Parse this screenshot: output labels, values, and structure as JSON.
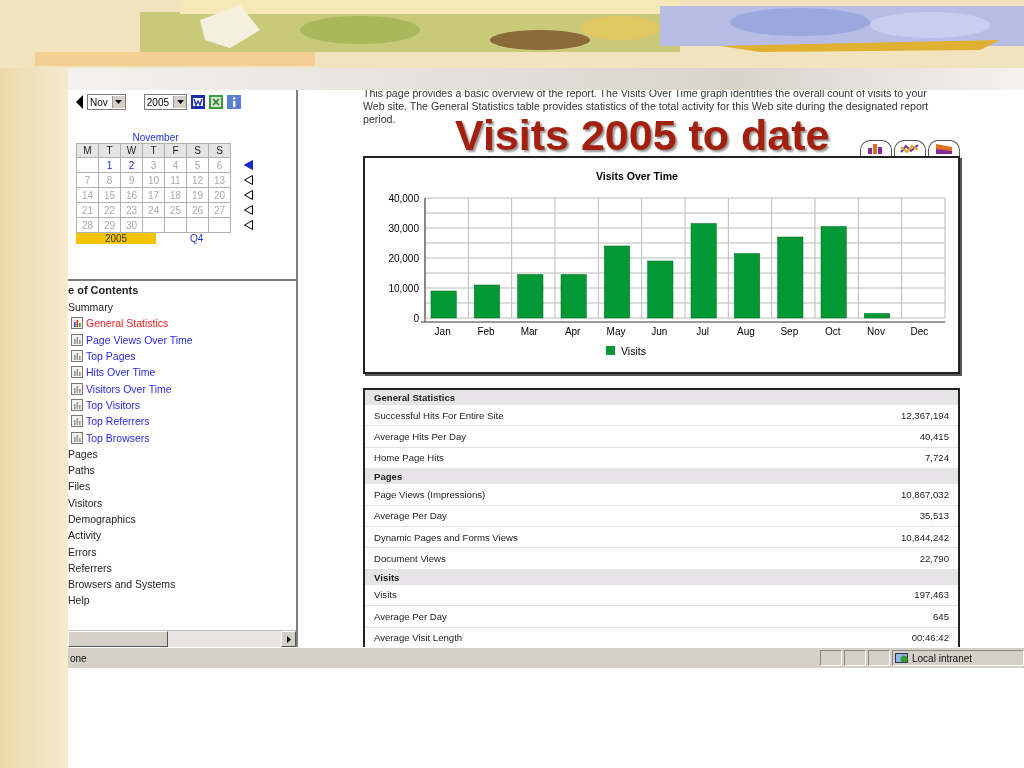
{
  "slide_title": "Visits 2005 to date",
  "nav": {
    "month": "Nov",
    "year": "2005"
  },
  "calendar": {
    "title": "November",
    "weekdays": [
      "M",
      "T",
      "W",
      "T",
      "F",
      "S",
      "S"
    ],
    "weeks": [
      {
        "selected": true,
        "days": [
          {
            "text": "1",
            "enabled": true
          },
          {
            "text": "2",
            "enabled": true
          },
          {
            "text": "3",
            "enabled": false
          },
          {
            "text": "4",
            "enabled": false
          },
          {
            "text": "5",
            "enabled": false
          },
          {
            "text": "6",
            "enabled": false
          }
        ]
      },
      {
        "selected": false,
        "days": [
          {
            "text": "7",
            "enabled": false
          },
          {
            "text": "8",
            "enabled": false
          },
          {
            "text": "9",
            "enabled": false
          },
          {
            "text": "10",
            "enabled": false
          },
          {
            "text": "11",
            "enabled": false
          },
          {
            "text": "12",
            "enabled": false
          },
          {
            "text": "13",
            "enabled": false
          }
        ]
      },
      {
        "selected": false,
        "days": [
          {
            "text": "14",
            "enabled": false
          },
          {
            "text": "15",
            "enabled": false
          },
          {
            "text": "16",
            "enabled": false
          },
          {
            "text": "17",
            "enabled": false
          },
          {
            "text": "18",
            "enabled": false
          },
          {
            "text": "19",
            "enabled": false
          },
          {
            "text": "20",
            "enabled": false
          }
        ]
      },
      {
        "selected": false,
        "days": [
          {
            "text": "21",
            "enabled": false
          },
          {
            "text": "22",
            "enabled": false
          },
          {
            "text": "23",
            "enabled": false
          },
          {
            "text": "24",
            "enabled": false
          },
          {
            "text": "25",
            "enabled": false
          },
          {
            "text": "26",
            "enabled": false
          },
          {
            "text": "27",
            "enabled": false
          }
        ]
      },
      {
        "selected": false,
        "days": [
          {
            "text": "28",
            "enabled": false
          },
          {
            "text": "29",
            "enabled": false
          },
          {
            "text": "30",
            "enabled": false
          }
        ]
      }
    ],
    "year": "2005",
    "quarter": "Q4"
  },
  "toc": {
    "title": "e of Contents",
    "items": [
      {
        "label": "Summary",
        "selected": false,
        "children": [
          {
            "label": "General Statistics",
            "selected": true
          },
          {
            "label": "Page Views Over Time",
            "selected": false
          },
          {
            "label": "Top Pages",
            "selected": false
          },
          {
            "label": "Hits Over Time",
            "selected": false
          },
          {
            "label": "Visitors Over Time",
            "selected": false
          },
          {
            "label": "Top Visitors",
            "selected": false
          },
          {
            "label": "Top Referrers",
            "selected": false
          },
          {
            "label": "Top Browsers",
            "selected": false
          }
        ]
      },
      {
        "label": "Pages",
        "selected": false
      },
      {
        "label": "Paths",
        "selected": false
      },
      {
        "label": "Files",
        "selected": false
      },
      {
        "label": "Visitors",
        "selected": false
      },
      {
        "label": "Demographics",
        "selected": false
      },
      {
        "label": "Activity",
        "selected": false
      },
      {
        "label": "Errors",
        "selected": false
      },
      {
        "label": "Referrers",
        "selected": false
      },
      {
        "label": "Browsers and Systems",
        "selected": false
      },
      {
        "label": "Help",
        "selected": false
      }
    ]
  },
  "intro": "This page provides a basic overview of the report. The Visits Over Time graph identifies the overall count of visits to your Web site. The General Statistics table provides statistics of the total activity for this Web site during the designated report period.",
  "chart": {
    "chart_data": {
      "type": "bar",
      "title": "Visits Over Time",
      "categories": [
        "Jan",
        "Feb",
        "Mar",
        "Apr",
        "May",
        "Jun",
        "Jul",
        "Aug",
        "Sep",
        "Oct",
        "Nov",
        "Dec"
      ],
      "series": [
        {
          "name": "Visits",
          "color": "#009933",
          "values": [
            9000,
            11000,
            14500,
            14500,
            24000,
            19000,
            31500,
            21500,
            27000,
            30500,
            1500,
            0
          ]
        }
      ],
      "ylim": [
        0,
        40000
      ],
      "grid": true,
      "yticks": [
        {
          "value": 0,
          "label": "0"
        },
        {
          "value": 10000,
          "label": "10,000"
        },
        {
          "value": 20000,
          "label": "20,000"
        },
        {
          "value": 30000,
          "label": "30,000"
        },
        {
          "value": 40000,
          "label": "40,000"
        }
      ]
    }
  },
  "table": {
    "sections": [
      {
        "title": "General Statistics",
        "rows": [
          {
            "label": "Successful Hits For Entire Site",
            "value": "12,367,194"
          },
          {
            "label": "Average Hits Per Day",
            "value": "40,415"
          },
          {
            "label": "Home Page Hits",
            "value": "7,724"
          }
        ]
      },
      {
        "title": "Pages",
        "rows": [
          {
            "label": "Page Views (Impressions)",
            "value": "10,867,032"
          },
          {
            "label": "Average Per Day",
            "value": "35,513"
          },
          {
            "label": "Dynamic Pages and Forms Views",
            "value": "10,844,242"
          },
          {
            "label": "Document Views",
            "value": "22,790"
          }
        ]
      },
      {
        "title": "Visits",
        "rows": [
          {
            "label": "Visits",
            "value": "197,463"
          },
          {
            "label": "Average Per Day",
            "value": "645"
          },
          {
            "label": "Average Visit Length",
            "value": "00:46:42"
          }
        ]
      }
    ]
  },
  "status_bar": {
    "text": "one",
    "zone": "Local intranet"
  }
}
